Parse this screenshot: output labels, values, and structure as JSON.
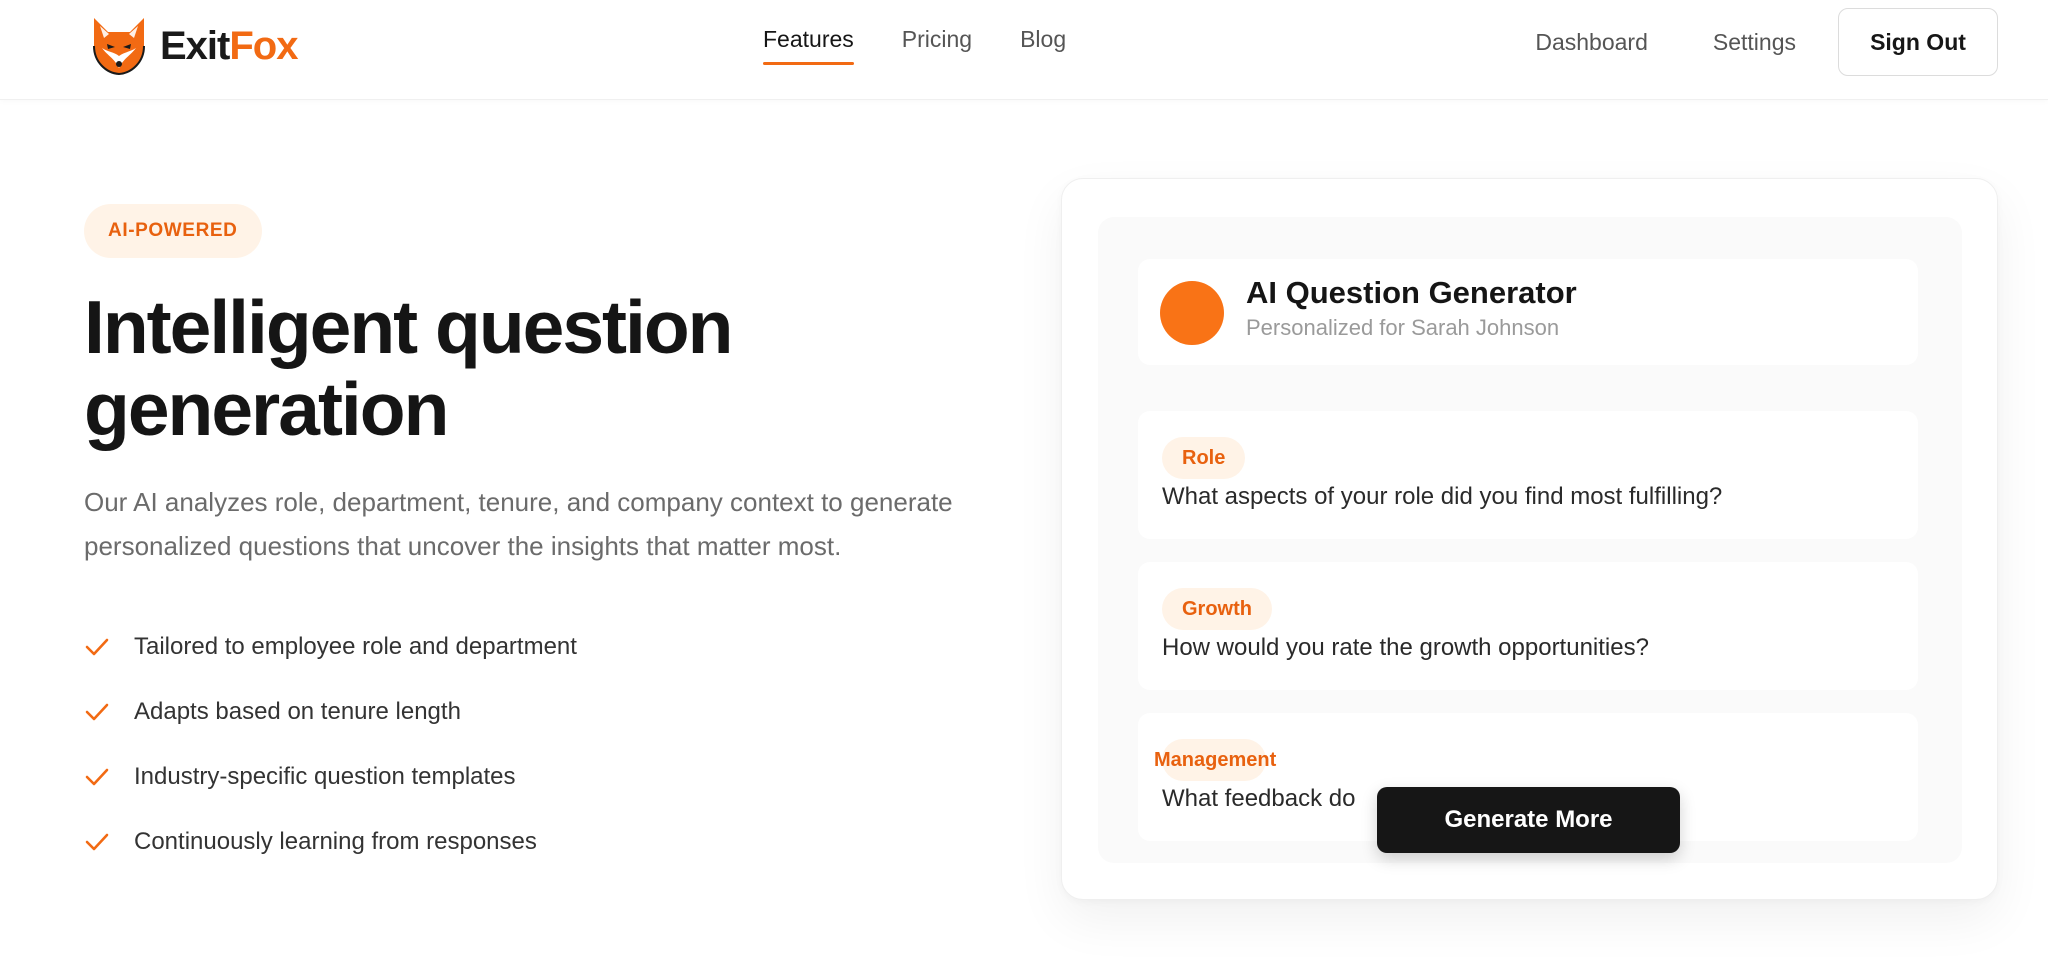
{
  "brand": {
    "name_part1": "Exit",
    "name_part2": "Fox",
    "accent_color": "#f26a13",
    "logo_icon": "fox-head-icon"
  },
  "nav": {
    "center": [
      {
        "label": "Features",
        "active": true
      },
      {
        "label": "Pricing",
        "active": false
      },
      {
        "label": "Blog",
        "active": false
      }
    ],
    "right": {
      "dashboard": "Dashboard",
      "settings": "Settings",
      "sign_out": "Sign Out"
    }
  },
  "hero": {
    "badge": "AI-POWERED",
    "headline_line1": "Intelligent question",
    "headline_line2": "generation",
    "description": "Our AI analyzes role, department, tenure, and company context to generate personalized questions that uncover the insights that matter most.",
    "features": [
      "Tailored to employee role and department",
      "Adapts based on tenure length",
      "Industry-specific question templates",
      "Continuously learning from responses"
    ]
  },
  "generator": {
    "title": "AI Question Generator",
    "subtitle": "Personalized for Sarah Johnson",
    "questions": [
      {
        "tag": "Role",
        "text": "What aspects of your role did you find most fulfilling?"
      },
      {
        "tag": "Growth",
        "text": "How would you rate the growth opportunities?"
      },
      {
        "tag": "Management",
        "text": "What feedback do",
        "text_tail": "?"
      }
    ],
    "button": "Generate More"
  }
}
